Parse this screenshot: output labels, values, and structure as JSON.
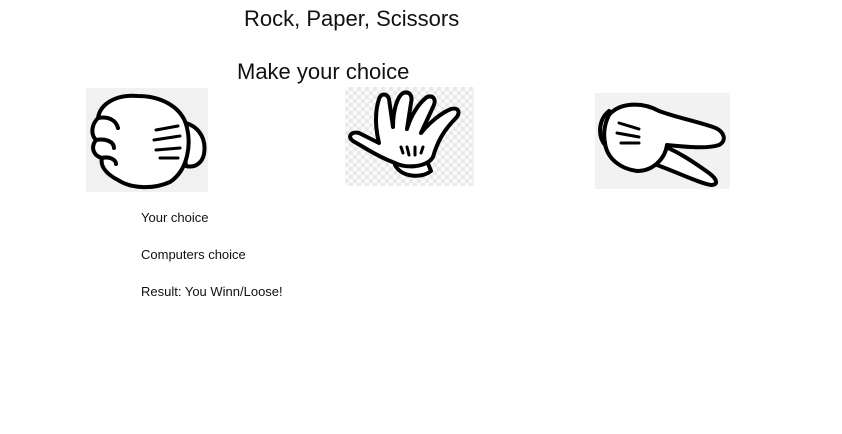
{
  "title": "Rock, Paper, Scissors",
  "subtitle": "Make your choice",
  "choices": [
    {
      "id": "rock",
      "icon": "rock-hand-icon"
    },
    {
      "id": "paper",
      "icon": "paper-hand-icon"
    },
    {
      "id": "scissors",
      "icon": "scissors-hand-icon"
    }
  ],
  "results": {
    "your_choice_label": "Your choice",
    "computer_choice_label": "Computers choice",
    "result_label": "Result: You Winn/Loose!"
  },
  "colors": {
    "background": "#ffffff",
    "text": "#111111",
    "outline": "#000000"
  }
}
